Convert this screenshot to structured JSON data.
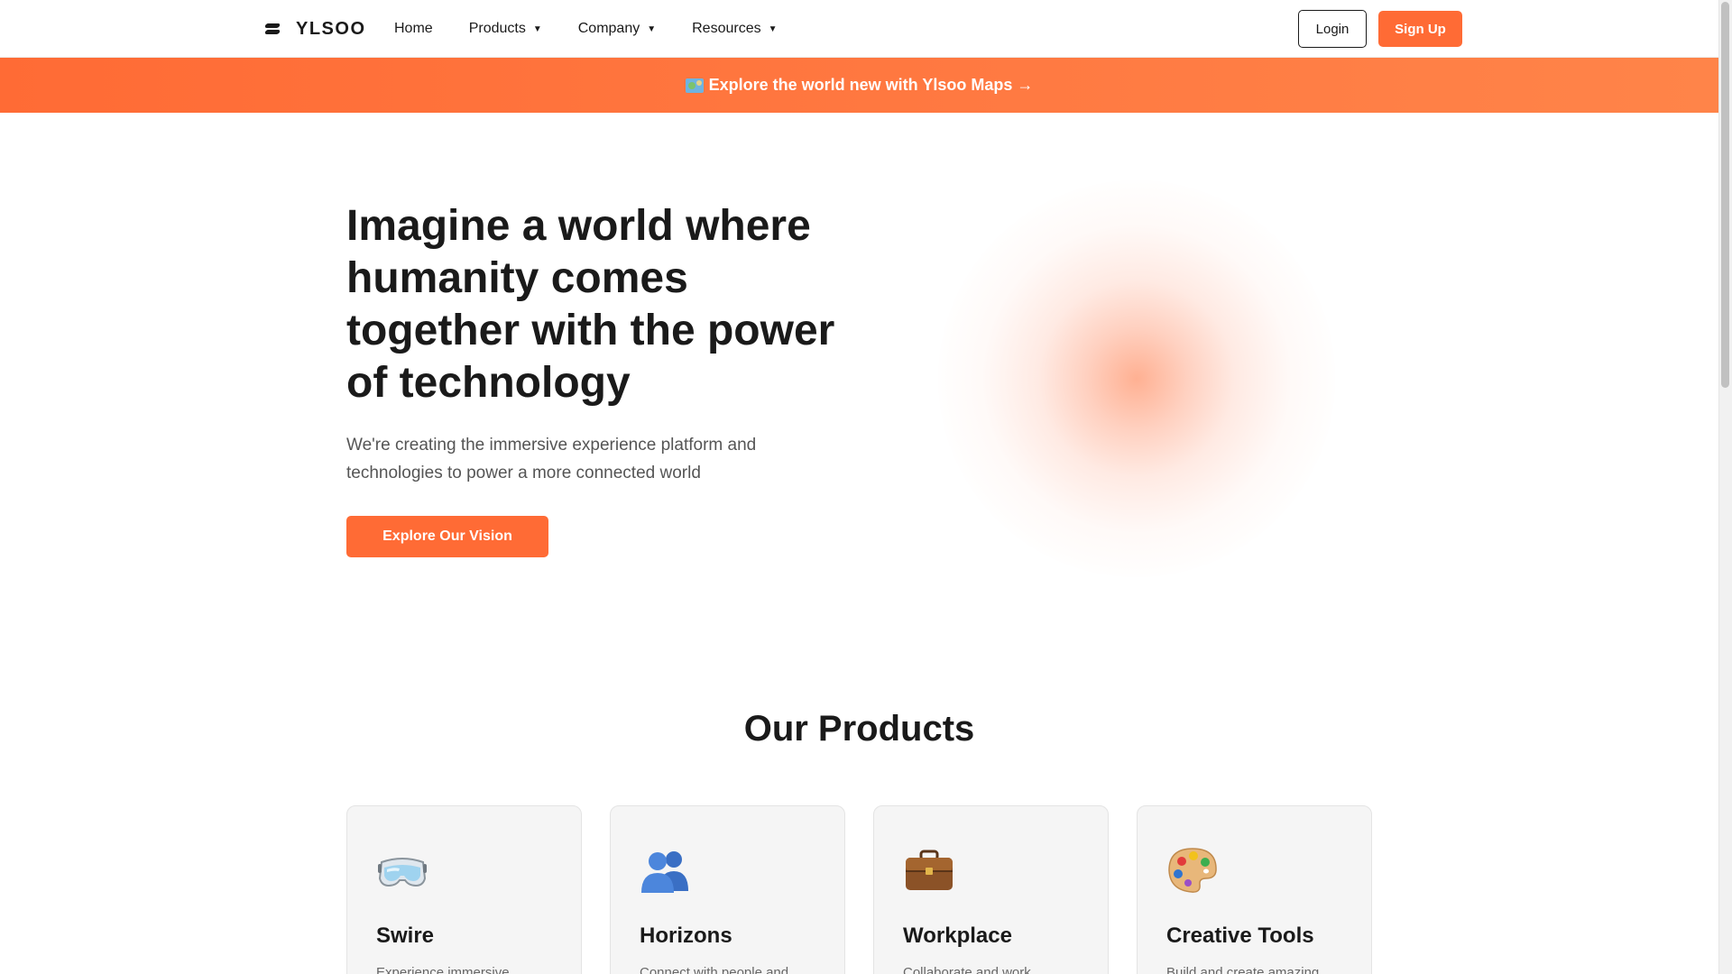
{
  "nav": {
    "brand": "YLSOO",
    "links": [
      {
        "label": "Home"
      },
      {
        "label": "Products",
        "caret": "▼"
      },
      {
        "label": "Company",
        "caret": "▼"
      },
      {
        "label": "Resources",
        "caret": "▼"
      }
    ],
    "login_label": "Login",
    "signup_label": "Sign Up"
  },
  "banner": {
    "icon": "world-map-icon",
    "text": "Explore the world new with Ylsoo Maps →"
  },
  "hero": {
    "title": "Imagine a world where humanity comes together with the power of technology",
    "subtitle": "We're creating the immersive experience platform and technologies to power a more connected world",
    "cta_label": "Explore Our Vision"
  },
  "products": {
    "heading": "Our Products",
    "items": [
      {
        "icon": "goggles-icon",
        "title": "Swire",
        "description": "Experience immersive"
      },
      {
        "icon": "people-icon",
        "title": "Horizons",
        "description": "Connect with people and"
      },
      {
        "icon": "briefcase-icon",
        "title": "Workplace",
        "description": "Collaborate and work"
      },
      {
        "icon": "palette-icon",
        "title": "Creative Tools",
        "description": "Build and create amazing"
      }
    ]
  },
  "colors": {
    "accent": "#ff6b35",
    "text": "#1a1a1a",
    "muted": "#555555",
    "card_bg": "#f5f5f5"
  }
}
